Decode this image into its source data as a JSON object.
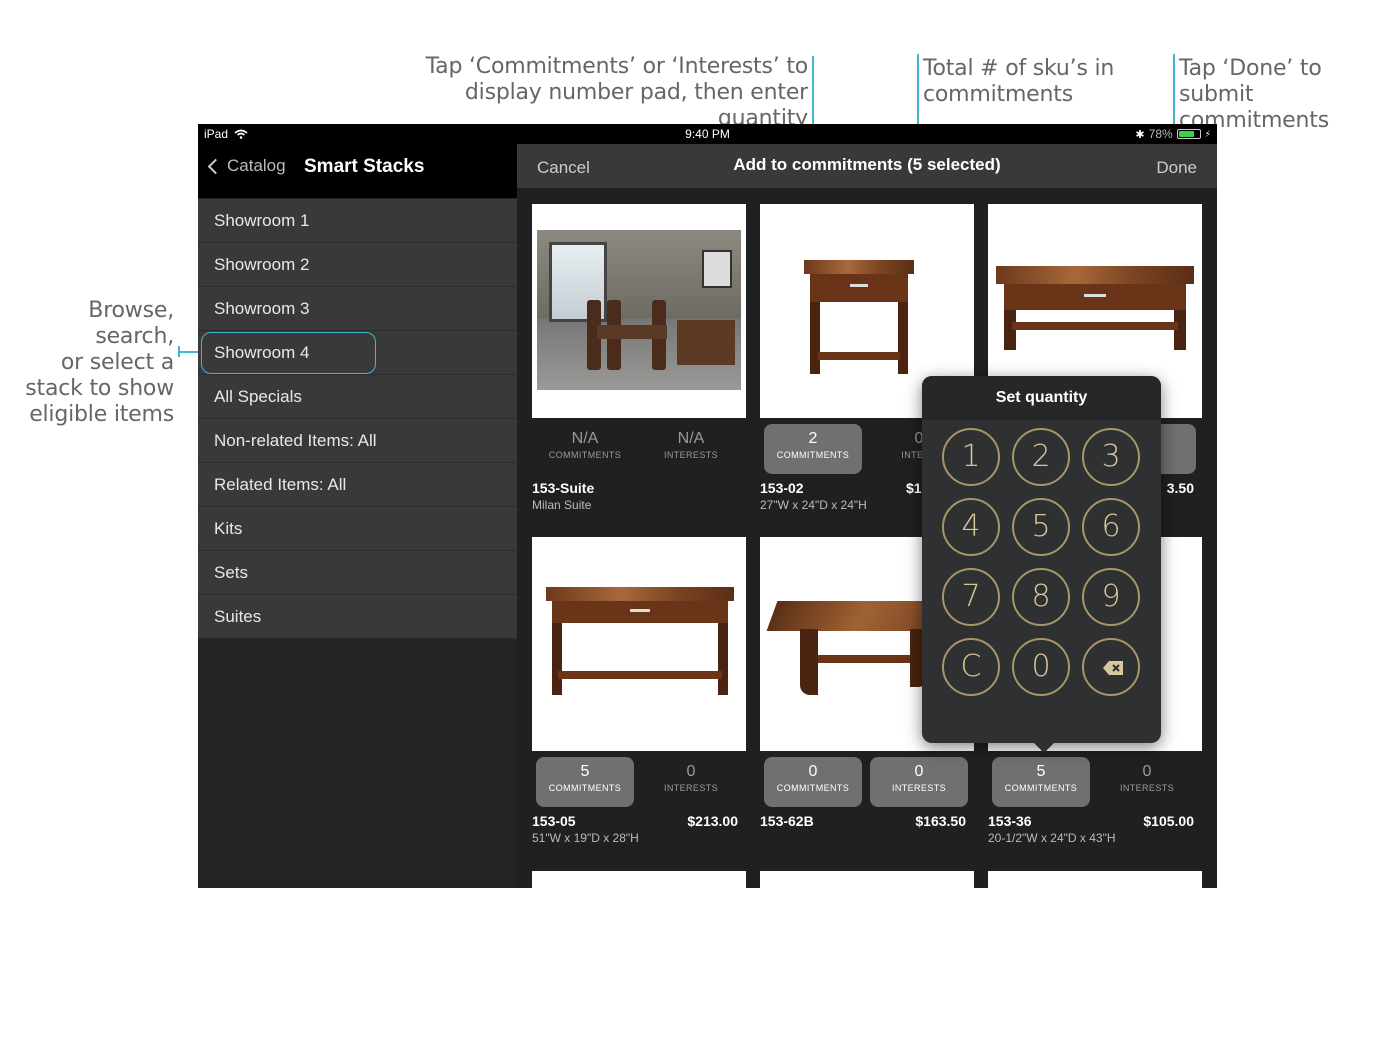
{
  "annotations": {
    "a1_line1": "Tap ‘Commitments’ or ‘Interests’ to",
    "a1_line2": "display number pad, then enter quantity",
    "a2_line1": "Total # of sku’s in",
    "a2_line2": "commitments",
    "a3_line1": "Tap ‘Done’ to submit",
    "a3_line2": "commitments",
    "a4_line1": "Browse, search,",
    "a4_line2": "or select a",
    "a4_line3": "stack to show",
    "a4_line4": "eligible items"
  },
  "statusbar": {
    "device": "iPad",
    "time": "9:40 PM",
    "battery": "78%"
  },
  "sidebar": {
    "back_label": "Catalog",
    "title": "Smart Stacks",
    "items": [
      {
        "label": "Showroom 1"
      },
      {
        "label": "Showroom 2"
      },
      {
        "label": "Showroom 3"
      },
      {
        "label": "Showroom 4"
      },
      {
        "label": "All Specials"
      },
      {
        "label": "Non-related Items:  All"
      },
      {
        "label": "Related Items:  All"
      },
      {
        "label": "Kits"
      },
      {
        "label": "Sets"
      },
      {
        "label": "Suites"
      }
    ]
  },
  "main": {
    "cancel_label": "Cancel",
    "title": "Add to commitments (5 selected)",
    "done_label": "Done",
    "cards": [
      {
        "sku": "153-Suite",
        "sub": "Milan Suite",
        "price": "",
        "commit": "N/A",
        "commit_label": "COMMITMENTS",
        "interest": "N/A",
        "interest_label": "INTERESTS"
      },
      {
        "sku": "153-02",
        "sub": "27\"W x 24\"D x 24\"H",
        "price": "$1",
        "commit": "2",
        "commit_label": "COMMITMENTS",
        "interest": "0",
        "interest_label": "INTERE"
      },
      {
        "sku": "",
        "sub": "",
        "price": "3.50",
        "commit": "",
        "commit_label": "",
        "interest": "",
        "interest_label": "TS"
      },
      {
        "sku": "153-05",
        "sub": "51\"W x 19\"D x 28\"H",
        "price": "$213.00",
        "commit": "5",
        "commit_label": "COMMITMENTS",
        "interest": "0",
        "interest_label": "INTERESTS"
      },
      {
        "sku": "153-62B",
        "sub": "",
        "price": "$163.50",
        "commit": "0",
        "commit_label": "COMMITMENTS",
        "interest": "0",
        "interest_label": "INTERESTS"
      },
      {
        "sku": "153-36",
        "sub": "20-1/2\"W x 24\"D x 43\"H",
        "price": "$105.00",
        "commit": "5",
        "commit_label": "COMMITMENTS",
        "interest": "0",
        "interest_label": "INTERESTS"
      }
    ]
  },
  "keypad": {
    "title": "Set quantity",
    "keys": [
      "1",
      "2",
      "3",
      "4",
      "5",
      "6",
      "7",
      "8",
      "9",
      "C",
      "0"
    ],
    "backspace_icon": "backspace-icon"
  },
  "colors": {
    "annotation_line": "#3fb6d2",
    "key_gold": "#d8c79a"
  }
}
